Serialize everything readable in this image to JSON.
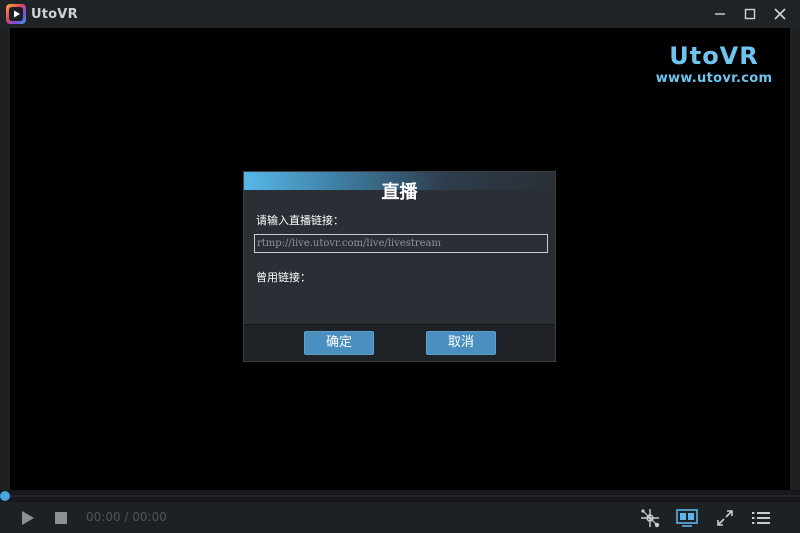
{
  "window": {
    "title": "UtoVR"
  },
  "brand": {
    "title": "UtoVR",
    "url": "www.utovr.com"
  },
  "dialog": {
    "title": "直播",
    "link_label": "请输入直播链接：",
    "link_placeholder": "rtmp://live.utovr.com/live/livestream",
    "link_value": "",
    "common_label": "曾用链接：",
    "ok_label": "确定",
    "cancel_label": "取消"
  },
  "player": {
    "time": "00:00 / 00:00",
    "progress": 0
  },
  "colors": {
    "accent": "#4aa3df",
    "button": "#4a8fc0",
    "brand": "#6ec6f0",
    "icon": "#c9cdd1"
  }
}
